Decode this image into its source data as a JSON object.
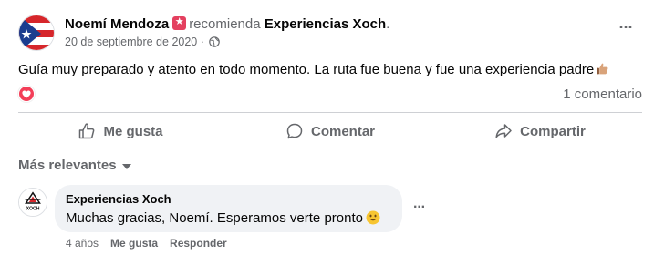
{
  "post": {
    "author": "Noemí Mendoza",
    "recommends_text": "recomienda",
    "page_name": "Experiencias Xoch",
    "period": ".",
    "date": "20 de septiembre de 2020",
    "separator": "·",
    "text": "Guía muy preparado y atento en todo momento. La ruta fue buena y fue una experiencia padre",
    "reaction_icon": "love-reaction-icon",
    "comment_count": "1 comentario",
    "more_icon": "more-options-icon"
  },
  "actions": {
    "like": "Me gusta",
    "comment": "Comentar",
    "share": "Compartir"
  },
  "sort": {
    "label": "Más relevantes"
  },
  "comment": {
    "author": "Experiencias Xoch",
    "avatar_text": "XOCH",
    "text": "Muchas gracias, Noemí. Esperamos verte pronto",
    "time": "4 años",
    "like": "Me gusta",
    "reply": "Responder"
  },
  "colors": {
    "text_primary": "#050505",
    "text_secondary": "#65676b",
    "love_red": "#f33e58",
    "recommend_badge": "#e4405f",
    "bubble_bg": "#f0f2f5",
    "divider": "#ced0d4"
  }
}
